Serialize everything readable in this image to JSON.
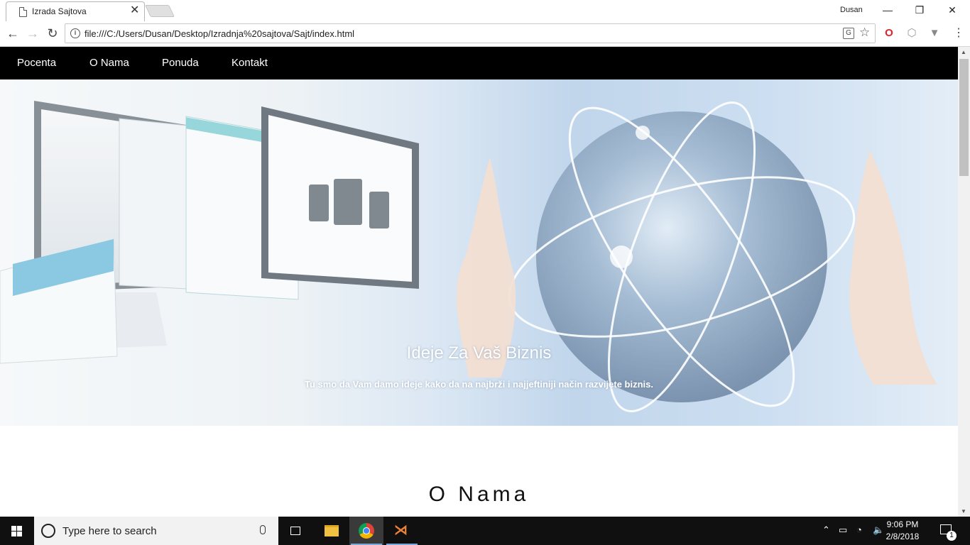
{
  "browser": {
    "tab_title": "Izrada Sajtova",
    "tab_close": "✕",
    "user_name": "Dusan",
    "url": "file:///C:/Users/Dusan/Desktop/Izradnja%20sajtova/Sajt/index.html",
    "window_controls": {
      "minimize": "—",
      "restore": "❐",
      "close": "✕"
    },
    "icons": [
      "back-icon",
      "forward-icon",
      "reload-icon",
      "info-icon",
      "translate-icon",
      "star-icon",
      "opera-icon",
      "extension-cube-icon",
      "extension-vee-icon",
      "menu-icon"
    ]
  },
  "site": {
    "nav": [
      "Pocenta",
      "O Nama",
      "Ponuda",
      "Kontakt"
    ],
    "hero": {
      "title": "Ideje Za Vaš Biznis",
      "subtitle": "Tu smo da Vam damo ideje kako da na najbrži i najjeftiniji način razvijete biznis."
    },
    "section_title": "O Nama"
  },
  "taskbar": {
    "search_placeholder": "Type here to search",
    "time": "9:06 PM",
    "date": "2/8/2018",
    "notification_count": "1",
    "apps": [
      "task-view",
      "file-explorer",
      "chrome",
      "visual-studio"
    ]
  }
}
